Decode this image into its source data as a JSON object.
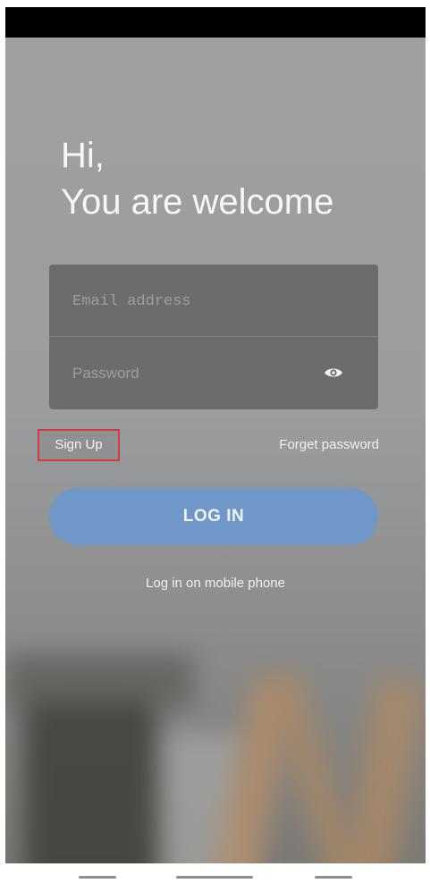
{
  "greeting": {
    "line1": "Hi,",
    "line2": "You are welcome"
  },
  "form": {
    "email_placeholder": "Email address",
    "password_placeholder": "Password",
    "password_toggle_icon": "eye-icon"
  },
  "links": {
    "sign_up": "Sign Up",
    "forget_password": "Forget password",
    "mobile_login": "Log in on mobile phone"
  },
  "login_button": {
    "label": "LOG IN"
  },
  "colors": {
    "accent": "#6f98c8",
    "highlight_box": "#d73a3a"
  }
}
